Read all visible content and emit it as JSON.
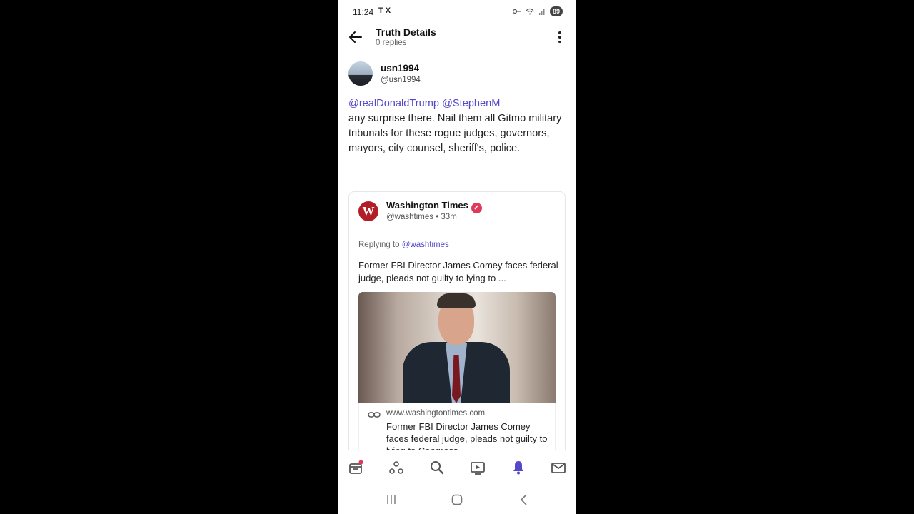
{
  "status_bar": {
    "time": "11:24",
    "left_icons": "T X",
    "battery": "89"
  },
  "header": {
    "title": "Truth Details",
    "subtitle": "0 replies"
  },
  "post": {
    "author_name": "usn1994",
    "author_handle": "@usn1994",
    "mention_1": "@realDonaldTrump",
    "mention_2": "@StephenM",
    "body": "any surprise there. Nail them all Gitmo military tribunals for these rogue judges, governors, mayors, city counsel, sheriff's, police."
  },
  "quote": {
    "logo_letter": "W",
    "name": "Washington Times",
    "handle_time": "@washtimes • 33m",
    "replying_prefix": "Replying to",
    "replying_handle": "@washtimes",
    "text": "Former FBI Director James Comey faces federal judge, pleads not guilty to lying to ...",
    "link_domain": "www.washingtontimes.com",
    "link_title": "Former FBI Director James Comey faces federal judge, pleads not guilty to lying to Congress"
  },
  "nav": {
    "items": [
      "inbox-icon",
      "groups-icon",
      "search-icon",
      "tv-icon",
      "notifications-icon",
      "messages-icon"
    ],
    "active": "notifications-icon",
    "active_color": "#5448c8",
    "badge_color": "#e03a5a"
  },
  "colors": {
    "accent": "#5448c8",
    "verified": "#e03a5a",
    "brand_wt": "#b11e26"
  }
}
